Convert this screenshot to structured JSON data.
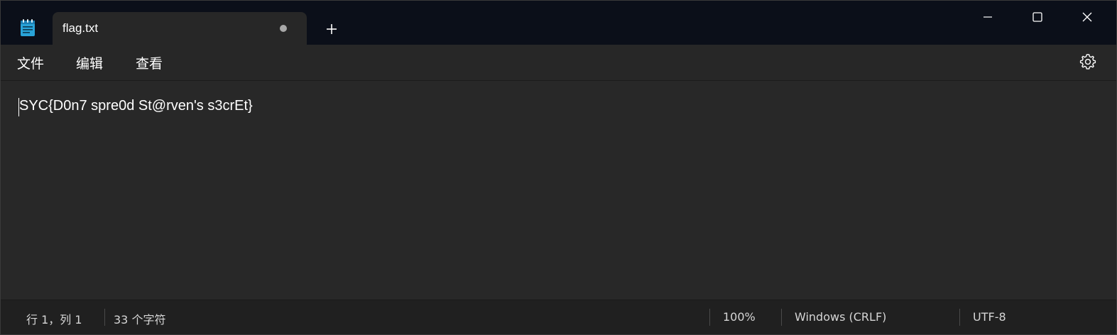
{
  "tab": {
    "title": "flag.txt",
    "unsaved_indicator": "dot"
  },
  "icons": {
    "app": "notepad-icon",
    "new_tab": "plus-icon",
    "minimize": "minimize-icon",
    "maximize": "maximize-icon",
    "close": "close-icon",
    "settings": "gear-icon"
  },
  "menu": {
    "file": "文件",
    "edit": "编辑",
    "view": "查看"
  },
  "editor": {
    "content": "SYC{D0n7 spre0d St@rven's s3crEt}"
  },
  "status": {
    "position": "行 1，列 1",
    "char_count": "33 个字符",
    "zoom": "100%",
    "line_ending": "Windows (CRLF)",
    "encoding": "UTF-8"
  },
  "colors": {
    "titlebar": "#0b0f19",
    "editor_bg": "#282828",
    "statusbar": "#202020",
    "text": "#ffffff"
  }
}
